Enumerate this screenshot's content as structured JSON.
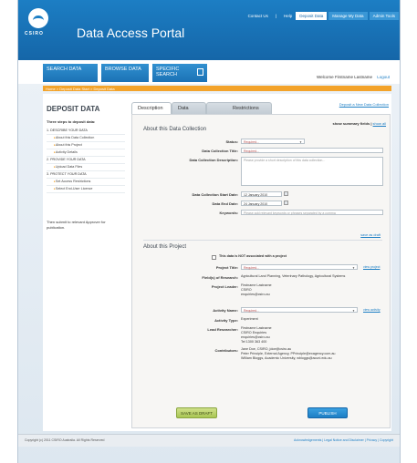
{
  "header": {
    "logo_text": "CSIRO",
    "title": "Data Access Portal",
    "nav": [
      "Contact Us",
      "Help",
      "Deposit Data",
      "Manage My Data",
      "Admin Tools"
    ]
  },
  "navbar": {
    "search": "SEARCH DATA",
    "browse": "BROWSE DATA",
    "specific": "SPECIFIC SEARCH",
    "welcome": "Welcome Firstname Lastname",
    "logout": "Logout"
  },
  "breadcrumb": "Home > Deposit Data Start > Deposit Data",
  "sidebar": {
    "title": "DEPOSIT DATA",
    "subtitle": "Three steps to deposit data:",
    "items": [
      {
        "label": "1. DESCRIBE YOUR DATA",
        "sub": false
      },
      {
        "label": "About this Data Collection",
        "sub": true
      },
      {
        "label": "About this Project",
        "sub": true
      },
      {
        "label": "Activity Details",
        "sub": true
      },
      {
        "label": "2. PROVIDE YOUR DATA",
        "sub": false
      },
      {
        "label": "Upload Data Files",
        "sub": true
      },
      {
        "label": "3. PROTECT YOUR DATA",
        "sub": false
      },
      {
        "label": "Set Access Restrictions",
        "sub": true
      },
      {
        "label": "Select End-User Licence",
        "sub": true
      }
    ],
    "footer": "Then submit to relevant Approver for publication."
  },
  "tabs": [
    "Description",
    "Data",
    "Restrictions"
  ],
  "export_link": "Deposit a New Data Collection",
  "summary": {
    "label": "show summary fields",
    "link": "show all"
  },
  "collection": {
    "title": "About this Data Collection",
    "status_label": "Status:",
    "status_value": "Required...",
    "title_label": "Data Collection Title:",
    "title_value": "Required...",
    "desc_label": "Data Collection Description:",
    "desc_placeholder": "Please provide a short description of this data collection...",
    "start_label": "Data Collection Start Date:",
    "start_value": "12 January 2010",
    "end_label": "Data End Date:",
    "end_value": "24 January 2010",
    "keywords_label": "Keywords:",
    "keywords_placeholder": "Please add relevant keywords or phrases separated by a comma",
    "save_link": "save as draft"
  },
  "project": {
    "title": "About this Project",
    "not_associated": "This data is NOT associated with a project",
    "project_title_label": "Project Title:",
    "project_title_value": "Required...",
    "view_project": "view project",
    "field_label": "Field(s) of Research:",
    "field_value": "Agricultural Land Planning, Veterinary Pathology, Agricultural Systems",
    "leader_label": "Project Leader:",
    "leader_value": [
      "Firstname Lastname",
      "CSIRO",
      "enquiries@csiro.au"
    ],
    "activity_label": "Activity Name:",
    "activity_value": "Required...",
    "view_activity": "view activity",
    "type_label": "Activity Type:",
    "type_value": "Experiment",
    "lead_label": "Lead Researcher:",
    "lead_value": [
      "Firstname Lastname",
      "CSIRO Enquiries",
      "enquiries@csiro.au",
      "Tel 1300 363 400"
    ],
    "contrib_label": "Contributors:",
    "contrib_value": [
      "Jane Doe, CSIRO, jdoe@csiro.au",
      "Peter Principle, External Agency, PPrinciple@exagency.com.au",
      "William Bloggs, Academic University, wbloggs@acuni.edu.au"
    ]
  },
  "buttons": {
    "draft": "SAVE AS DRAFT",
    "publish": "PUBLISH"
  },
  "footer": {
    "copyright": "Copyright (c) 2011 CSIRO Australia. All Rights Reserved",
    "links": "Acknowledgements | Legal Notice and Disclaimer | Privacy | Copyright"
  }
}
